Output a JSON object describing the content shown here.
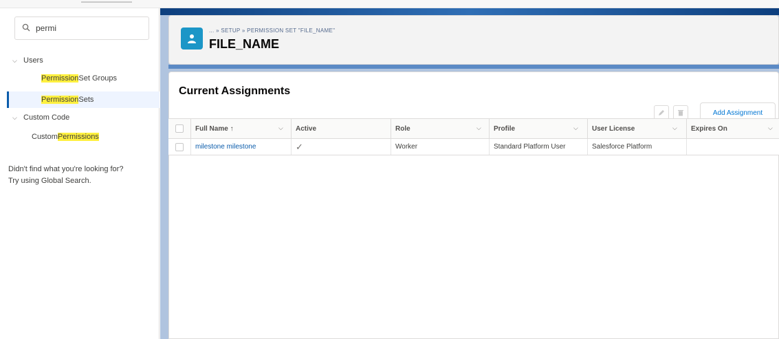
{
  "sidebar": {
    "search_value": "permi",
    "tree": {
      "users": "Users",
      "permission_set_groups": {
        "pre": "",
        "hl": "Permission",
        "post": " Set Groups"
      },
      "permission_sets": {
        "pre": "",
        "hl": "Permission",
        "post": " Sets"
      },
      "custom_code": "Custom Code",
      "custom_permissions": {
        "pre": "Custom ",
        "hl": "Permissions",
        "post": ""
      }
    },
    "note_line1": "Didn't find what you're looking for?",
    "note_line2": "Try using Global Search."
  },
  "header": {
    "breadcrumb": "... » SETUP » PERMISSION SET \"FILE_NAME\"",
    "title": "FILE_NAME"
  },
  "card": {
    "title": "Current Assignments",
    "add_button": "Add Assignment"
  },
  "table": {
    "columns": [
      "Full Name ↑",
      "Active",
      "Role",
      "Profile",
      "User License",
      "Expires On"
    ],
    "rows": [
      {
        "full_name": "milestone milestone",
        "active": "✓",
        "role": "Worker",
        "profile": "Standard Platform User",
        "user_license": "Salesforce Platform",
        "expires_on": ""
      }
    ]
  },
  "colors": {
    "brand_blue": "#0b5cab",
    "header_icon": "#1b96c7",
    "highlight": "#fff03f"
  },
  "icons": {
    "search": "search-icon",
    "user": "user-icon",
    "edit": "pencil-icon",
    "delete": "trash-icon"
  }
}
